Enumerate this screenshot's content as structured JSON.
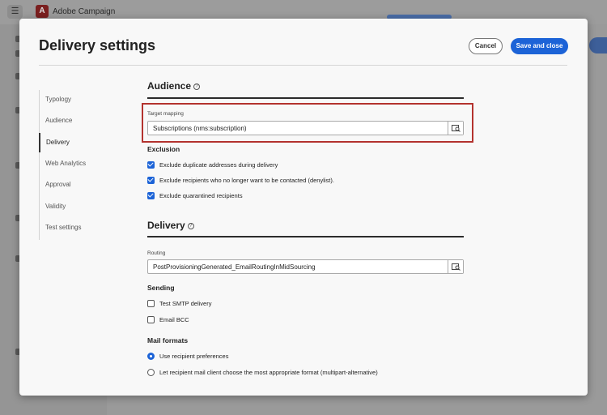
{
  "app": {
    "brand_name": "Adobe Campaign",
    "brand_logo_letter": "A"
  },
  "modal": {
    "title": "Delivery settings",
    "cancel_label": "Cancel",
    "save_label": "Save and close"
  },
  "nav": {
    "items": [
      {
        "label": "Typology",
        "active": false
      },
      {
        "label": "Audience",
        "active": false
      },
      {
        "label": "Delivery",
        "active": true
      },
      {
        "label": "Web Analytics",
        "active": false
      },
      {
        "label": "Approval",
        "active": false
      },
      {
        "label": "Validity",
        "active": false
      },
      {
        "label": "Test settings",
        "active": false
      }
    ]
  },
  "audience": {
    "title": "Audience",
    "target_mapping_label": "Target mapping",
    "target_mapping_value": "Subscriptions (nms:subscription)",
    "exclusion_title": "Exclusion",
    "exclusions": [
      {
        "label": "Exclude duplicate addresses during delivery",
        "checked": true
      },
      {
        "label": "Exclude recipients who no longer want to be contacted (denylist).",
        "checked": true
      },
      {
        "label": "Exclude quarantined recipients",
        "checked": true
      }
    ]
  },
  "delivery": {
    "title": "Delivery",
    "routing_label": "Routing",
    "routing_value": "PostProvisioningGenerated_EmailRoutingInMidSourcing",
    "sending_title": "Sending",
    "sending_options": [
      {
        "label": "Test SMTP delivery",
        "checked": false
      },
      {
        "label": "Email BCC",
        "checked": false
      }
    ],
    "mail_formats_title": "Mail formats",
    "mail_formats": [
      {
        "label": "Use recipient preferences",
        "selected": true
      },
      {
        "label": "Let recipient mail client choose the most appropriate format (multipart-alternative)",
        "selected": false
      }
    ]
  },
  "colors": {
    "accent": "#1c63d7",
    "highlight": "#b3322e"
  }
}
